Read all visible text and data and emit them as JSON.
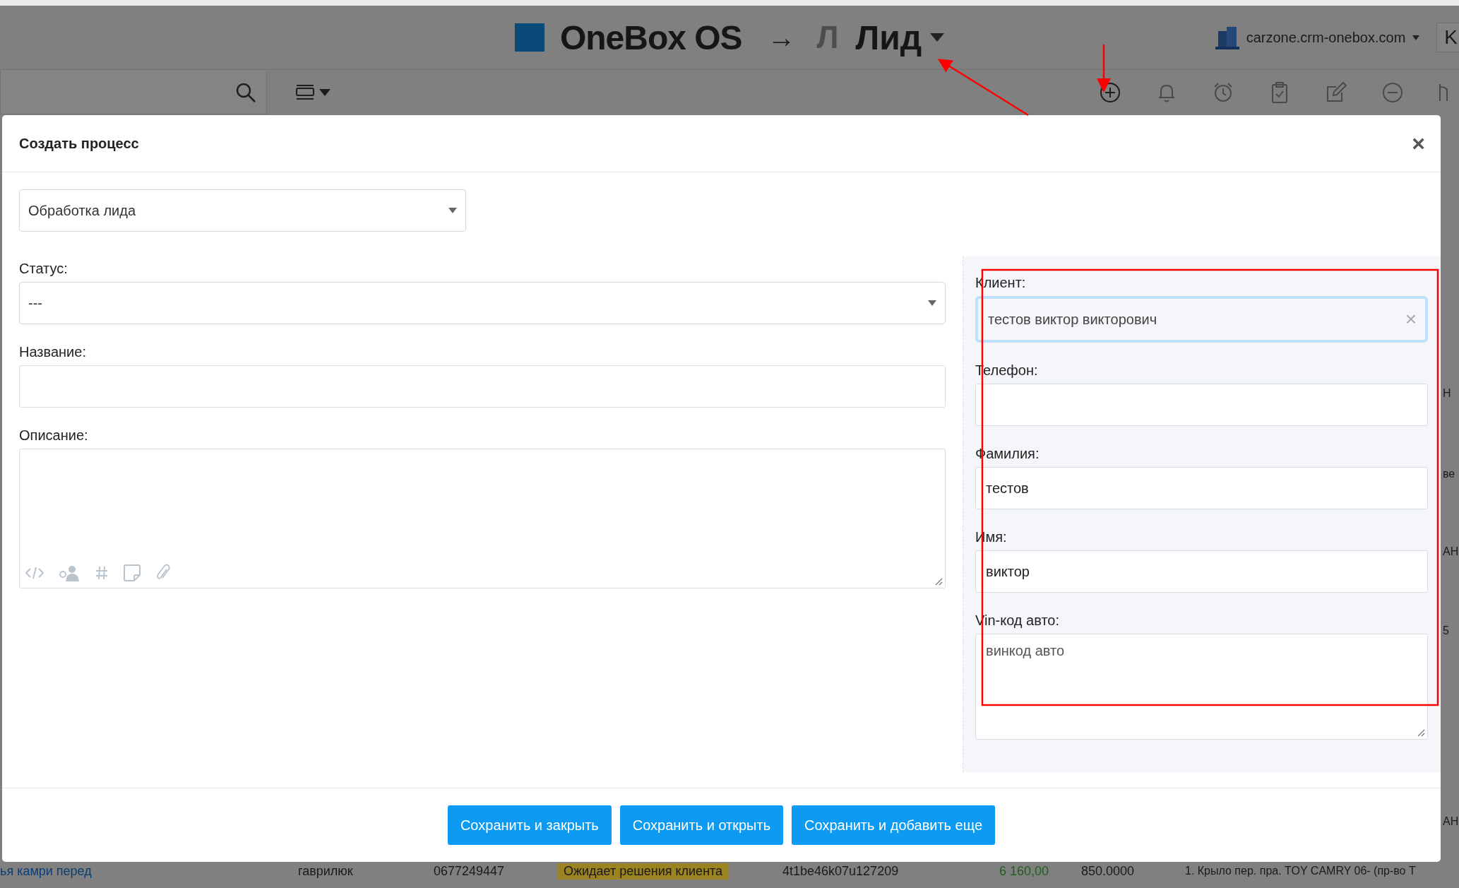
{
  "header": {
    "logo_text": "OneBox OS",
    "arrow": "→",
    "section_letter": "Л",
    "section": "Лид",
    "domain": "carzone.crm-onebox.com",
    "user_initial": "K"
  },
  "dialog": {
    "title": "Создать процесс",
    "close": "×",
    "process_type": "Обработка лида",
    "left_fields": [
      {
        "label": "Статус:",
        "kind": "select",
        "value": "---"
      },
      {
        "label": "Название:",
        "kind": "input"
      },
      {
        "label": "Описание:",
        "kind": "textarea"
      }
    ],
    "right_fields": [
      {
        "label": "Клиент:",
        "kind": "chip",
        "value": "тестов виктор викторович",
        "clear": "×",
        "focused": true
      },
      {
        "label": "Телефон:",
        "kind": "input"
      },
      {
        "label": "Фамилия:",
        "kind": "input",
        "value": "тестов"
      },
      {
        "label": "Имя:",
        "kind": "input",
        "value": "виктор"
      },
      {
        "label": "Vin-код авто:",
        "kind": "textarea",
        "placeholder": "винкод авто"
      }
    ],
    "buttons": [
      "Сохранить и закрыть",
      "Сохранить и открыть",
      "Сохранить и добавить еще"
    ]
  },
  "background_row": [
    {
      "kind": "link",
      "text": "ья камри перед"
    },
    {
      "kind": "text",
      "text": "гаврилюк"
    },
    {
      "kind": "text",
      "text": "0677249447"
    },
    {
      "kind": "badge",
      "text": "Ожидает решения клиента"
    },
    {
      "kind": "text",
      "text": "4t1be46k07u127209"
    },
    {
      "kind": "amount",
      "text": "6 160,00"
    },
    {
      "kind": "text",
      "text": "850.0000"
    },
    {
      "kind": "text",
      "text": "1. Крыло пер. пра. TOY CAMRY 06- (пр-во Т"
    }
  ],
  "right_edge_fragments": [
    "Н",
    "ве",
    "АН",
    "5",
    "АН"
  ]
}
